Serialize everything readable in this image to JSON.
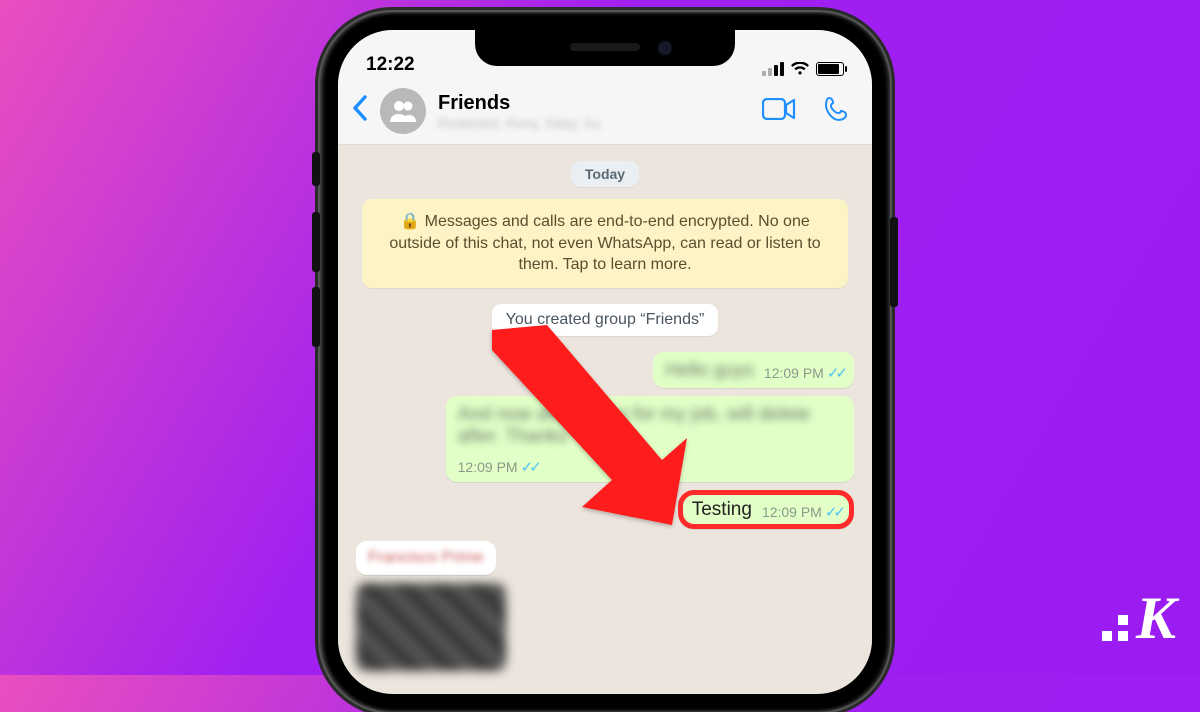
{
  "status": {
    "time": "12:22"
  },
  "header": {
    "title": "Friends",
    "subtitle": "Redacted, Rony, Saby, Su"
  },
  "chat": {
    "day_label": "Today",
    "encryption_notice": "Messages and calls are end-to-end encrypted. No one outside of this chat, not even WhatsApp, can read or listen to them. Tap to learn more.",
    "system_msg": "You created group “Friends”",
    "messages": [
      {
        "text": "Hello guys",
        "time": "12:09 PM",
        "blurred": true
      },
      {
        "text": "And now am waiting for my job, will delete after. Thanks",
        "time": "12:09 PM",
        "blurred": true
      },
      {
        "text": "Testing",
        "time": "12:09 PM",
        "blurred": false,
        "highlight": true
      }
    ],
    "incoming_sender": "Francisco Prime"
  },
  "icons": {
    "lock": "🔒"
  }
}
